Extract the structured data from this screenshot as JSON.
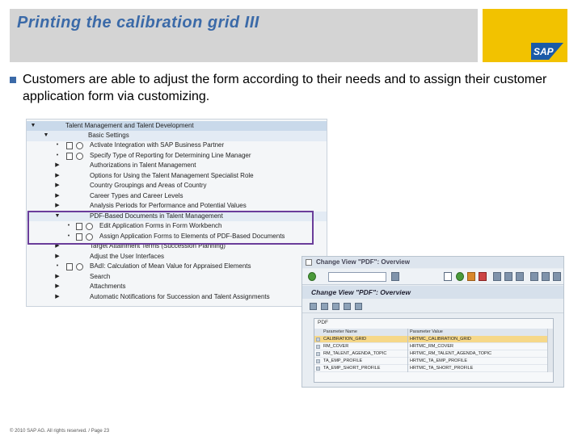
{
  "slide": {
    "title": "Printing the calibration grid III",
    "bullet": "Customers are able to adjust the form according to their needs and to assign their customer application form via customizing.",
    "footer": "© 2010 SAP AG. All rights reserved. / Page 23"
  },
  "logo": {
    "text": "SAP",
    "color": "#1a5aa8"
  },
  "colors": {
    "title": "#3b6aa8",
    "logo_band": "#f2c200",
    "highlight": "#6a3d9a"
  },
  "tree": {
    "root": "Talent Management and Talent Development",
    "basic": "Basic Settings",
    "items": [
      "Activate Integration with SAP Business Partner",
      "Specify Type of Reporting for Determining Line Manager",
      "Authorizations in Talent Management",
      "Options for Using the Talent Management Specialist Role",
      "Country Groupings and Areas of Country",
      "Career Types and Career Levels",
      "Analysis Periods for Performance and Potential Values",
      "PDF-Based Documents in Talent Management",
      "Edit Application Forms in Form Workbench",
      "Assign Application Forms to Elements of PDF-Based Documents",
      "Target Attainment Terms (Succession Planning)",
      "Adjust the User Interfaces",
      "BAdI: Calculation of Mean Value for Appraised Elements",
      "Search",
      "Attachments",
      "Automatic Notifications for Succession and Talent Assignments"
    ]
  },
  "sap_window": {
    "title": "Change View \"PDF\": Overview",
    "view_title": "Change View \"PDF\": Overview",
    "section": "PDF",
    "columns": [
      "Parameter Name",
      "Parameter Value"
    ],
    "rows": [
      [
        "CALIBRATION_GRID",
        "HRTMC_CALIBRATION_GRID"
      ],
      [
        "RM_COVER",
        "HRTMC_RM_COVER"
      ],
      [
        "RM_TALENT_AGENDA_TOPIC",
        "HRTMC_RM_TALENT_AGENDA_TOPIC"
      ],
      [
        "TA_EMP_PROFILE",
        "HRTMC_TA_EMP_PROFILE"
      ],
      [
        "TA_EMP_SHORT_PROFILE",
        "HRTMC_TA_SHORT_PROFILE"
      ]
    ],
    "selected_row": 0
  }
}
